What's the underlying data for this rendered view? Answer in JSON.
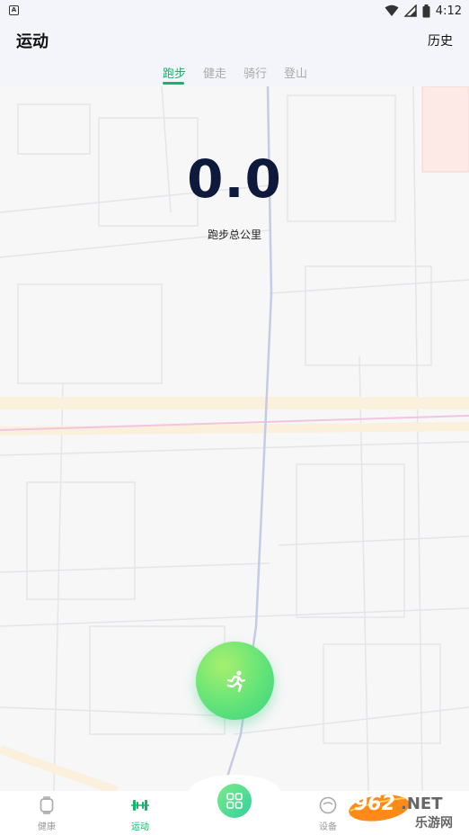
{
  "status_bar": {
    "left_icon": "A",
    "time": "4:12",
    "icons": [
      "wifi-icon",
      "signal-icon",
      "battery-icon"
    ]
  },
  "header": {
    "title": "运动",
    "history_label": "历史"
  },
  "tabs": [
    {
      "label": "跑步",
      "active": true
    },
    {
      "label": "健走",
      "active": false
    },
    {
      "label": "骑行",
      "active": false
    },
    {
      "label": "登山",
      "active": false
    }
  ],
  "stats": {
    "distance": "0.0",
    "distance_label": "跑步总公里"
  },
  "start_button": {
    "icon": "running-person-icon"
  },
  "bottom_nav": {
    "items": [
      {
        "label": "健康",
        "icon": "watch-icon",
        "active": false
      },
      {
        "label": "运动",
        "icon": "dumbbell-icon",
        "active": true
      },
      {
        "label": "",
        "icon": "grid-icon",
        "active": false
      },
      {
        "label": "设备",
        "icon": "device-icon",
        "active": false
      }
    ]
  },
  "watermark": {
    "brand": "962",
    "suffix": ".NET",
    "cn": "乐游网"
  },
  "colors": {
    "accent": "#18b26a",
    "distance_text": "#0e1a3c",
    "header_bg": "#f3f5fa",
    "map_bg": "#f7f7f8"
  }
}
